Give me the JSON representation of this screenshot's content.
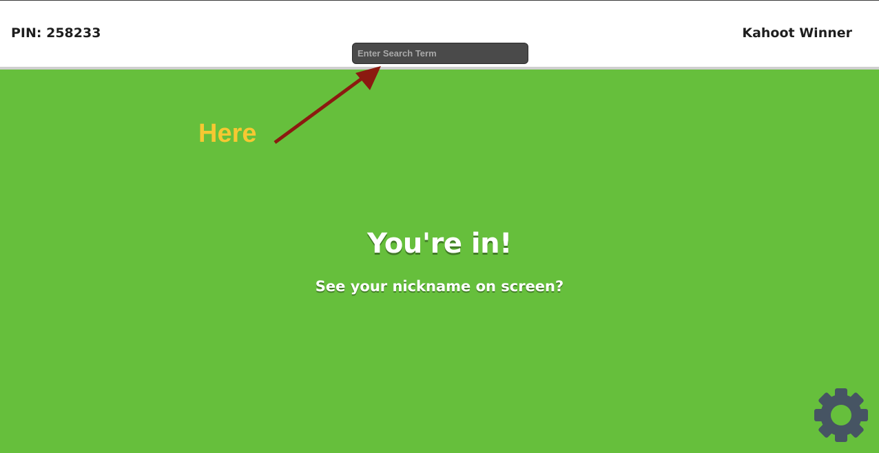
{
  "header": {
    "pin_label": "PIN: 258233",
    "nickname": "Kahoot Winner"
  },
  "search": {
    "placeholder": "Enter Search Term",
    "value": ""
  },
  "annotation": {
    "label": "Here"
  },
  "main": {
    "title": "You're in!",
    "subtitle": "See your nickname on screen?"
  },
  "icons": {
    "settings": "gear-icon"
  },
  "colors": {
    "stage_background": "#66bf3c",
    "annotation_text": "#f6c832",
    "arrow": "#8b1a10",
    "gear": "#465463",
    "search_background": "#4a4a4a"
  }
}
